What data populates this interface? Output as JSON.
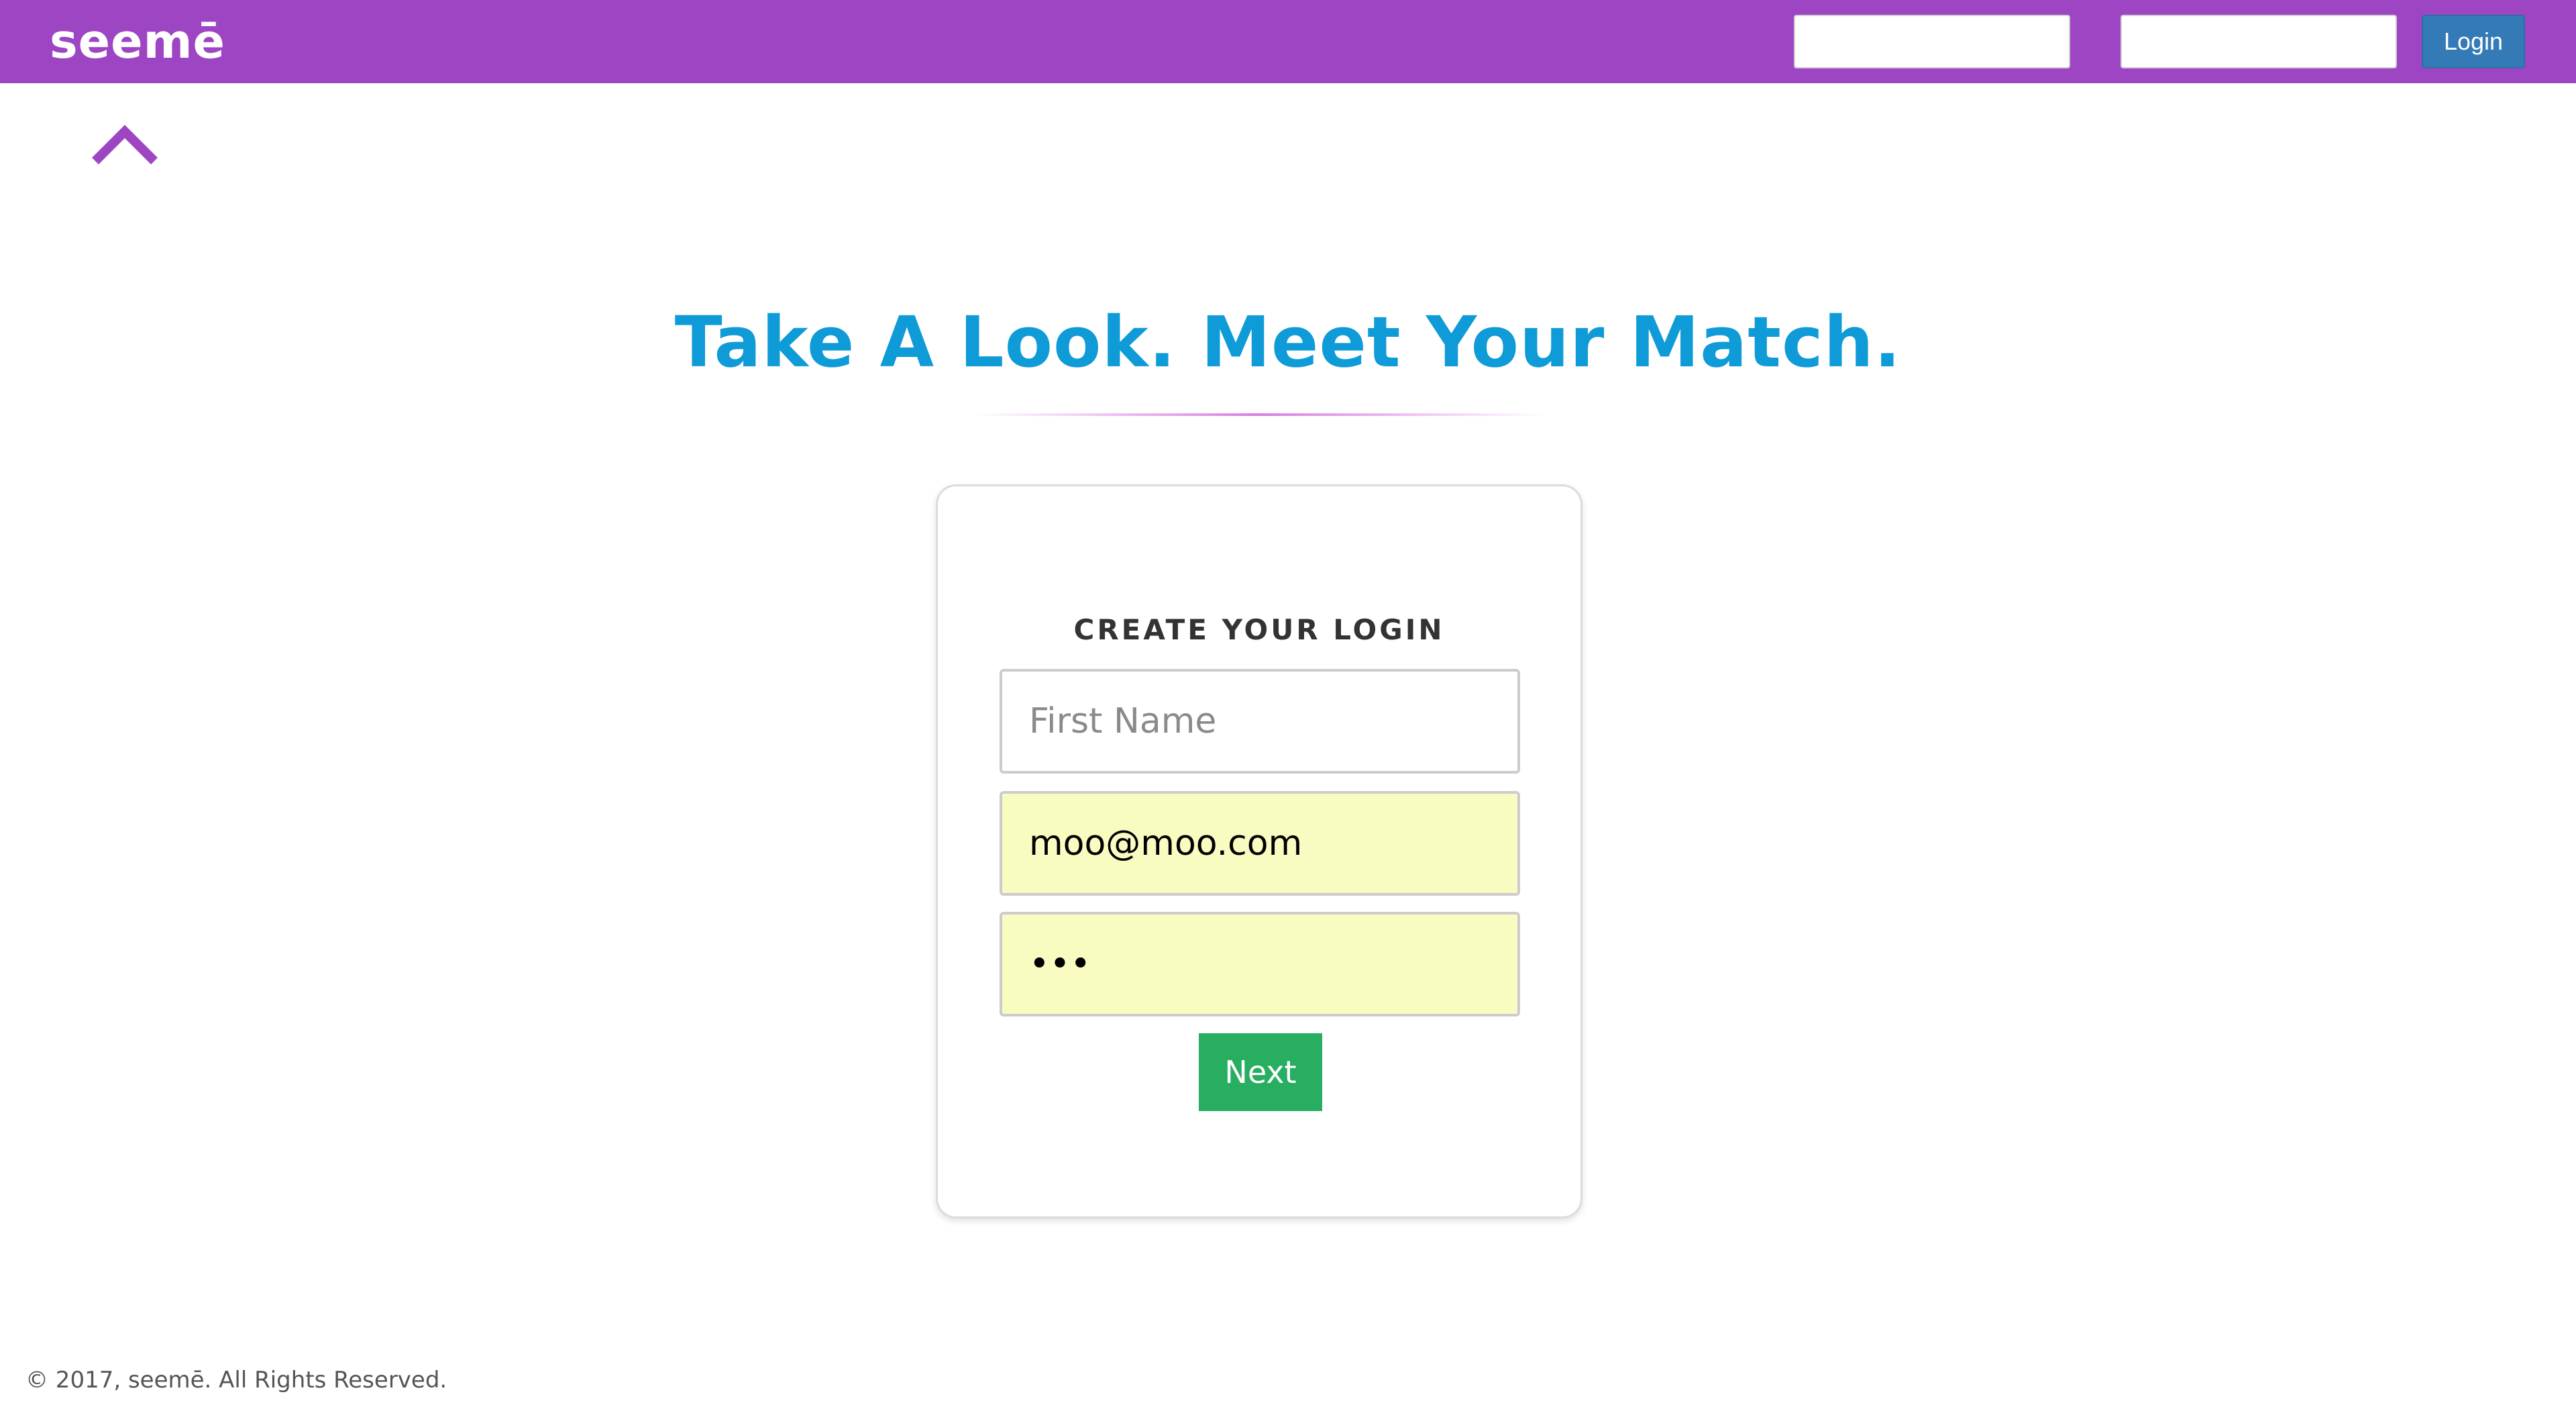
{
  "header": {
    "logo": "seemē",
    "username_value": "",
    "password_value": "",
    "login_label": "Login",
    "bar_color": "#9e45c4"
  },
  "nav": {
    "scroll_up_icon": "chevron-up-icon"
  },
  "hero": {
    "headline": "Take A Look. Meet Your Match.",
    "headline_color": "#0f9bd7"
  },
  "signup": {
    "title": "CREATE YOUR LOGIN",
    "first_name_placeholder": "First Name",
    "first_name_value": "",
    "email_value": "moo@moo.com",
    "password_value": "moo",
    "next_label": "Next",
    "next_color": "#27ae60",
    "autofill_color": "#f9fcc1"
  },
  "footer": {
    "copyright": "© 2017, seemē. All Rights Reserved."
  }
}
